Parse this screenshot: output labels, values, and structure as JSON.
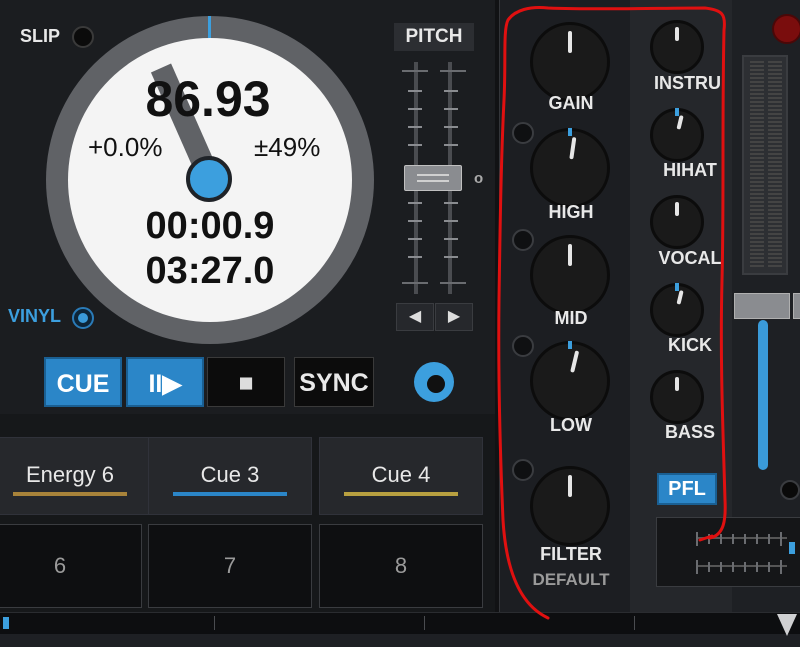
{
  "deck": {
    "slip_label": "SLIP",
    "vinyl_label": "VINYL",
    "bpm": "86.93",
    "pitch_percent": "+0.0%",
    "pitch_range": "±49%",
    "elapsed_time": "00:00.9",
    "remaining_time": "03:27.0",
    "pitch_label": "PITCH",
    "pitch_zero_marker": "o",
    "nudge_left_glyph": "◀",
    "nudge_right_glyph": "▶",
    "transport": {
      "cue_label": "CUE",
      "play_pause_glyph": "II▶",
      "stop_glyph": "■",
      "sync_label": "SYNC"
    },
    "hotcues": [
      {
        "label": "Energy 6",
        "color": "#a8833a"
      },
      {
        "label": "Cue 3",
        "color": "#2b86c8"
      },
      {
        "label": "Cue 4",
        "color": "#b8a040"
      }
    ],
    "pads": [
      "6",
      "7",
      "8"
    ],
    "accent_color": "#3c9fde"
  },
  "mixer": {
    "eq_knobs": [
      {
        "label": "GAIN",
        "level": 0.5
      },
      {
        "label": "HIGH",
        "level": 0.53
      },
      {
        "label": "MID",
        "level": 0.5
      },
      {
        "label": "LOW",
        "level": 0.55
      },
      {
        "label": "FILTER",
        "level": 0.5
      }
    ],
    "filter_mode": "DEFAULT",
    "stem_knobs": [
      {
        "label": "INSTRU",
        "level": 0.5
      },
      {
        "label": "HIHAT",
        "level": 0.55
      },
      {
        "label": "VOCAL",
        "level": 0.5
      },
      {
        "label": "KICK",
        "level": 0.55
      },
      {
        "label": "BASS",
        "level": 0.5
      }
    ],
    "pfl_label": "PFL"
  },
  "annotation_color": "#e01010"
}
